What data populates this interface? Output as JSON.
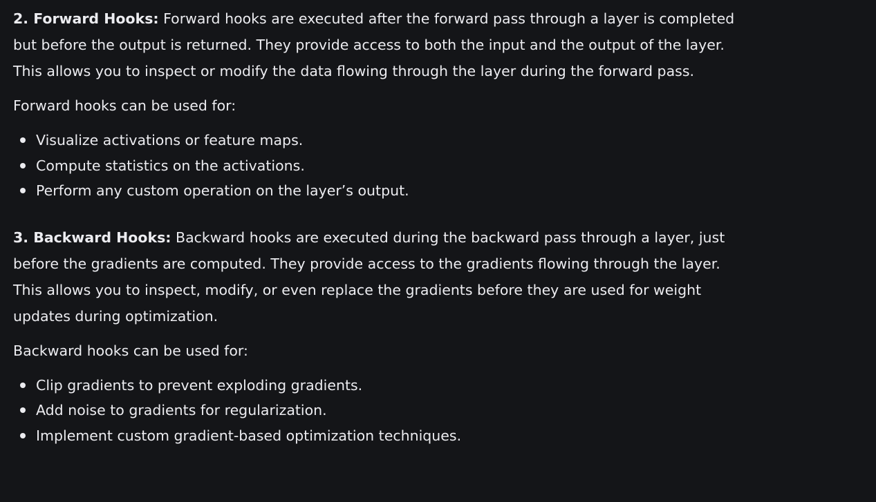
{
  "sections": [
    {
      "heading": "2. Forward Hooks:",
      "body": " Forward hooks are executed after the forward pass through a layer is completed but before the output is returned. They provide access to both the input and the output of the layer. This allows you to inspect or modify the data flowing through the layer during the forward pass.",
      "uses_intro": "Forward hooks can be used for:",
      "uses": [
        "Visualize activations or feature maps.",
        "Compute statistics on the activations.",
        "Perform any custom operation on the layer’s output."
      ]
    },
    {
      "heading": "3. Backward Hooks:",
      "body": " Backward hooks are executed during the backward pass through a layer, just before the gradients are computed. They provide access to the gradients flowing through the layer. This allows you to inspect, modify, or even replace the gradients before they are used for weight updates during optimization.",
      "uses_intro": "Backward hooks can be used for:",
      "uses": [
        "Clip gradients to prevent exploding gradients.",
        "Add noise to gradients for regularization.",
        "Implement custom gradient-based optimization techniques."
      ]
    }
  ]
}
